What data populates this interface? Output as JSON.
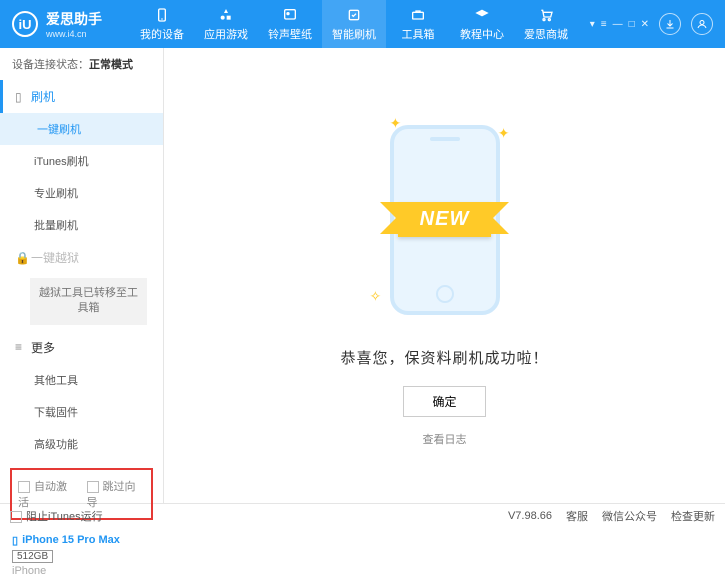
{
  "brand": {
    "name": "爱思助手",
    "url": "www.i4.cn",
    "logo_letter": "iU"
  },
  "nav": [
    {
      "label": "我的设备"
    },
    {
      "label": "应用游戏"
    },
    {
      "label": "铃声壁纸"
    },
    {
      "label": "智能刷机",
      "active": true
    },
    {
      "label": "工具箱"
    },
    {
      "label": "教程中心"
    },
    {
      "label": "爱思商城"
    }
  ],
  "status": {
    "prefix": "设备连接状态：",
    "value": "正常模式"
  },
  "sidebar": {
    "group_flash": "刷机",
    "items_flash": [
      "一键刷机",
      "iTunes刷机",
      "专业刷机",
      "批量刷机"
    ],
    "group_jailbreak": "一键越狱",
    "jailbreak_note": "越狱工具已转移至工具箱",
    "group_more": "更多",
    "items_more": [
      "其他工具",
      "下载固件",
      "高级功能"
    ]
  },
  "checkboxes": {
    "auto_activate": "自动激活",
    "skip_guide": "跳过向导"
  },
  "device": {
    "name": "iPhone 15 Pro Max",
    "storage": "512GB",
    "type": "iPhone"
  },
  "main": {
    "ribbon": "NEW",
    "success": "恭喜您，保资料刷机成功啦！",
    "ok": "确定",
    "log": "查看日志"
  },
  "footer": {
    "block_itunes": "阻止iTunes运行",
    "version": "V7.98.66",
    "links": [
      "客服",
      "微信公众号",
      "检查更新"
    ]
  }
}
